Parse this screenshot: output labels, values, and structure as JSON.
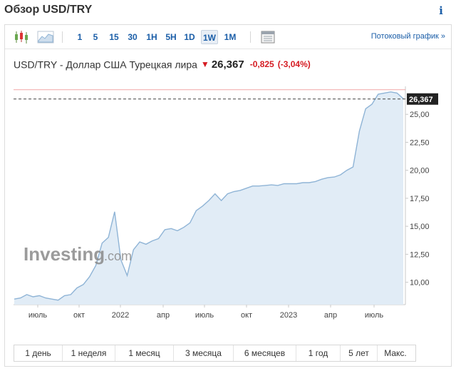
{
  "header": {
    "title": "Обзор USD/TRY",
    "info_icon": "i"
  },
  "toolbar": {
    "timeframes": [
      "1",
      "5",
      "15",
      "30",
      "1H",
      "5H",
      "1D",
      "1W",
      "1M"
    ],
    "active_timeframe": "1W",
    "stream_link": "Потоковый график »",
    "icons": [
      "candlestick-chart-icon",
      "area-chart-icon",
      "indicators-icon"
    ]
  },
  "quote": {
    "name": "USD/TRY - Доллар США Турецкая лира",
    "direction": "down",
    "price": "26,367",
    "change": "-0,825",
    "change_pct": "(-3,04%)"
  },
  "watermark": {
    "brand": "Investing",
    "suffix": ".com"
  },
  "ranges": [
    "1 день",
    "1 неделя",
    "1 месяц",
    "3 месяца",
    "6 месяцев",
    "1 год",
    "5 лет",
    "Макс."
  ],
  "colors": {
    "link": "#1b5ea8",
    "down": "#d51b22",
    "area_fill": "#e1ecf6",
    "line": "#8fb4d6"
  },
  "chart_data": {
    "type": "area",
    "x_tick_labels": [
      "июль",
      "окт",
      "2022",
      "апр",
      "июль",
      "окт",
      "2023",
      "апр",
      "июль"
    ],
    "y_tick_labels": [
      "10,00",
      "12,50",
      "15,00",
      "17,50",
      "20,00",
      "22,50",
      "25,00"
    ],
    "y_ticks": [
      10,
      12.5,
      15,
      17.5,
      20,
      22.5,
      25
    ],
    "ylim": [
      8.0,
      27.5
    ],
    "last_value_label": "26,367",
    "last_value": 26.367,
    "high_line_value": 27.2,
    "series": [
      {
        "x": [
          "2021-05",
          "2021-05",
          "2021-06",
          "2021-06",
          "2021-07",
          "2021-07",
          "2021-08",
          "2021-08",
          "2021-09",
          "2021-09",
          "2021-10",
          "2021-10",
          "2021-11",
          "2021-11",
          "2021-11",
          "2021-12",
          "2021-12",
          "2021-12",
          "2021-12",
          "2021-12",
          "2022-01",
          "2022-01",
          "2022-02",
          "2022-02",
          "2022-03",
          "2022-03",
          "2022-04",
          "2022-04",
          "2022-05",
          "2022-05",
          "2022-06",
          "2022-06",
          "2022-07",
          "2022-07",
          "2022-08",
          "2022-08",
          "2022-09",
          "2022-09",
          "2022-10",
          "2022-10",
          "2022-11",
          "2022-11",
          "2022-12",
          "2022-12",
          "2023-01",
          "2023-01",
          "2023-02",
          "2023-02",
          "2023-03",
          "2023-03",
          "2023-04",
          "2023-04",
          "2023-05",
          "2023-05",
          "2023-06",
          "2023-06",
          "2023-06",
          "2023-07",
          "2023-07",
          "2023-08",
          "2023-08",
          "2023-08",
          "2023-09"
        ],
        "values": [
          8.5,
          8.6,
          8.9,
          8.7,
          8.8,
          8.6,
          8.5,
          8.4,
          8.8,
          8.9,
          9.5,
          9.8,
          10.5,
          11.5,
          13.5,
          14.0,
          16.3,
          12.0,
          10.6,
          12.9,
          13.6,
          13.4,
          13.7,
          13.9,
          14.7,
          14.8,
          14.6,
          14.9,
          15.3,
          16.4,
          16.8,
          17.3,
          17.9,
          17.3,
          17.9,
          18.1,
          18.2,
          18.4,
          18.6,
          18.6,
          18.65,
          18.7,
          18.65,
          18.8,
          18.8,
          18.8,
          18.9,
          18.9,
          19.0,
          19.2,
          19.35,
          19.4,
          19.6,
          20.0,
          20.3,
          23.5,
          25.5,
          25.9,
          26.8,
          26.9,
          27.0,
          26.9,
          26.4
        ]
      }
    ]
  }
}
